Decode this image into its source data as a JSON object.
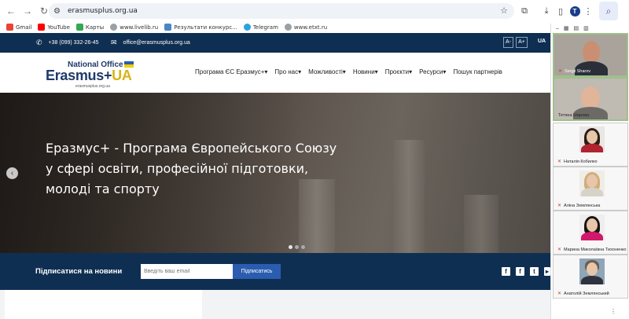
{
  "browser": {
    "url": "erasmusplus.org.ua",
    "profile_initial": "T",
    "bookmarks": [
      {
        "label": "Gmail",
        "color": "#ea4335"
      },
      {
        "label": "YouTube",
        "color": "#ff0000"
      },
      {
        "label": "Карты",
        "color": "#34a853"
      },
      {
        "label": "www.livelib.ru",
        "color": "#9aa0a6"
      },
      {
        "label": "Результати конкурс...",
        "color": "#4a86c5"
      },
      {
        "label": "Telegram",
        "color": "#2aa3de"
      },
      {
        "label": "www.etxt.ru",
        "color": "#9aa0a6"
      }
    ]
  },
  "site": {
    "topbar": {
      "phone": "+38 (099) 332-26-45",
      "email": "office@erasmusplus.org.ua",
      "font_minus": "A-",
      "font_plus": "A+",
      "lang": "UA"
    },
    "logo": {
      "office": "National Office",
      "main": "Erasmus+",
      "ua": "UA",
      "url": "erasmusplus.org.ua"
    },
    "menu": [
      "Програма ЄС Еразмус+▾",
      "Про нас▾",
      "Можливості▾",
      "Новини▾",
      "Проєкти▾",
      "Ресурси▾",
      "Пошук партнерів"
    ],
    "hero": {
      "line1": "Еразмус+ - Програма Європейського Союзу",
      "line2": "у сфері освіти, професійної підготовки,",
      "line3": "молоді та спорту",
      "prev_arrow": "‹"
    },
    "subscribe": {
      "label": "Підписатися на новини",
      "placeholder": "Введіть ваш email",
      "button": "Підписатись"
    }
  },
  "call": {
    "participants": [
      {
        "name": "Sergii Sharov"
      },
      {
        "name": "Тетяна Шарова"
      },
      {
        "name": "Наталія Кобилко"
      },
      {
        "name": "Аліна Землянська"
      },
      {
        "name": "Марина Миколаївна Тихоненко"
      },
      {
        "name": "Анатолій Землянський"
      }
    ],
    "more": "⋮"
  }
}
